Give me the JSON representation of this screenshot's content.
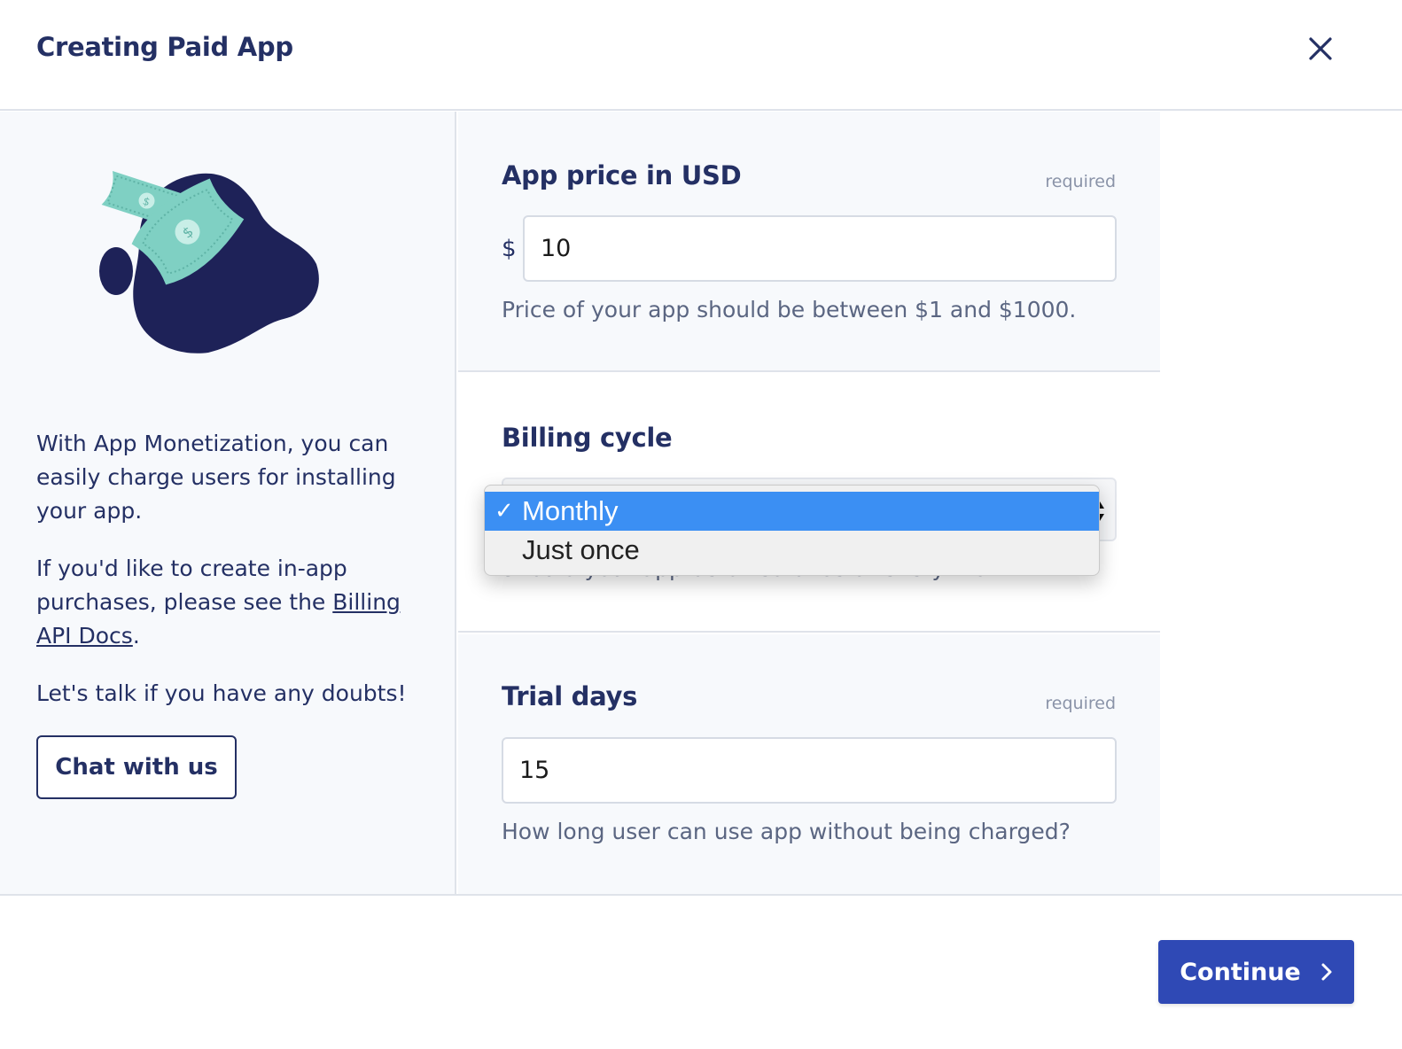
{
  "header": {
    "title": "Creating Paid App",
    "close_icon": "close-icon"
  },
  "left_panel": {
    "illustration": "money-illustration",
    "info_1": "With App Monetization, you can easily charge users for installing your app.",
    "info_2_prefix": "If you'd like to create in-app purchases, please see the ",
    "info_2_link": "Billing API Docs",
    "info_2_suffix": ".",
    "info_3": "Let's talk if you have any doubts!",
    "chat_button": "Chat with us"
  },
  "price": {
    "label": "App price in USD",
    "required": "required",
    "currency_symbol": "$",
    "value": "10",
    "help": "Price of your app should be between $1 and $1000."
  },
  "billing": {
    "label": "Billing cycle",
    "help": "Should your app be billed once or every month?",
    "options": [
      "Monthly",
      "Just once"
    ],
    "selected": "Monthly",
    "check_glyph": "✓"
  },
  "trial": {
    "label": "Trial days",
    "required": "required",
    "value": "15",
    "help": "How long user can use app without being charged?"
  },
  "footer": {
    "continue_label": "Continue",
    "continue_icon": "chevron-right-icon"
  },
  "colors": {
    "primary": "#2f49b5",
    "text_dark": "#243064",
    "panel_bg": "#f7f9fc",
    "illustration_dark": "#1e2258",
    "illustration_money": "#7fd0c3",
    "dropdown_highlight": "#3b8ff3"
  }
}
